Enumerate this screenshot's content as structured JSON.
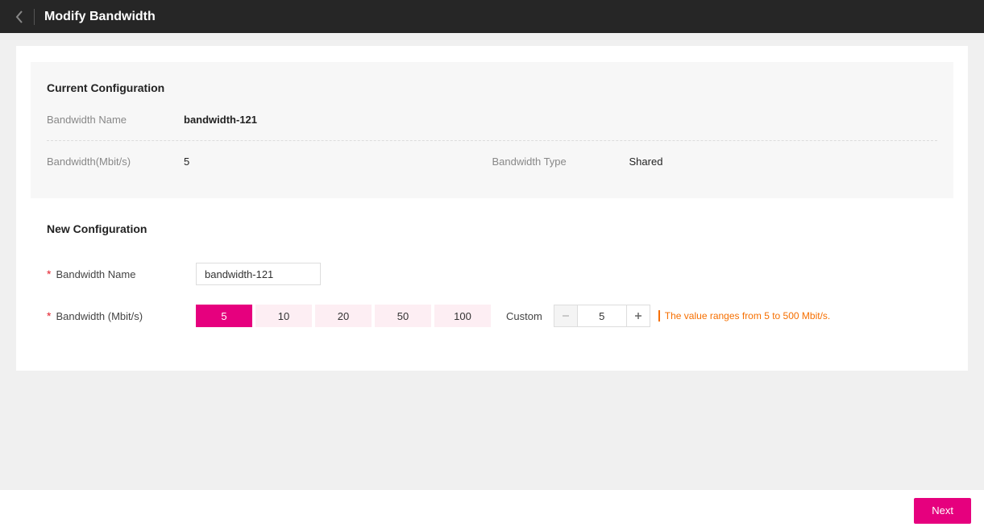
{
  "header": {
    "title": "Modify Bandwidth"
  },
  "current": {
    "section_title": "Current Configuration",
    "name_label": "Bandwidth Name",
    "name_value": "bandwidth-121",
    "bw_label": "Bandwidth(Mbit/s)",
    "bw_value": "5",
    "type_label": "Bandwidth Type",
    "type_value": "Shared"
  },
  "newcfg": {
    "section_title": "New Configuration",
    "name_label": "Bandwidth Name",
    "name_value": "bandwidth-121",
    "bw_label": "Bandwidth (Mbit/s)",
    "options": [
      "5",
      "10",
      "20",
      "50",
      "100"
    ],
    "selected": "5",
    "custom_label": "Custom",
    "custom_value": "5",
    "range_note": "The value ranges from 5 to 500 Mbit/s."
  },
  "footer": {
    "next_label": "Next"
  }
}
